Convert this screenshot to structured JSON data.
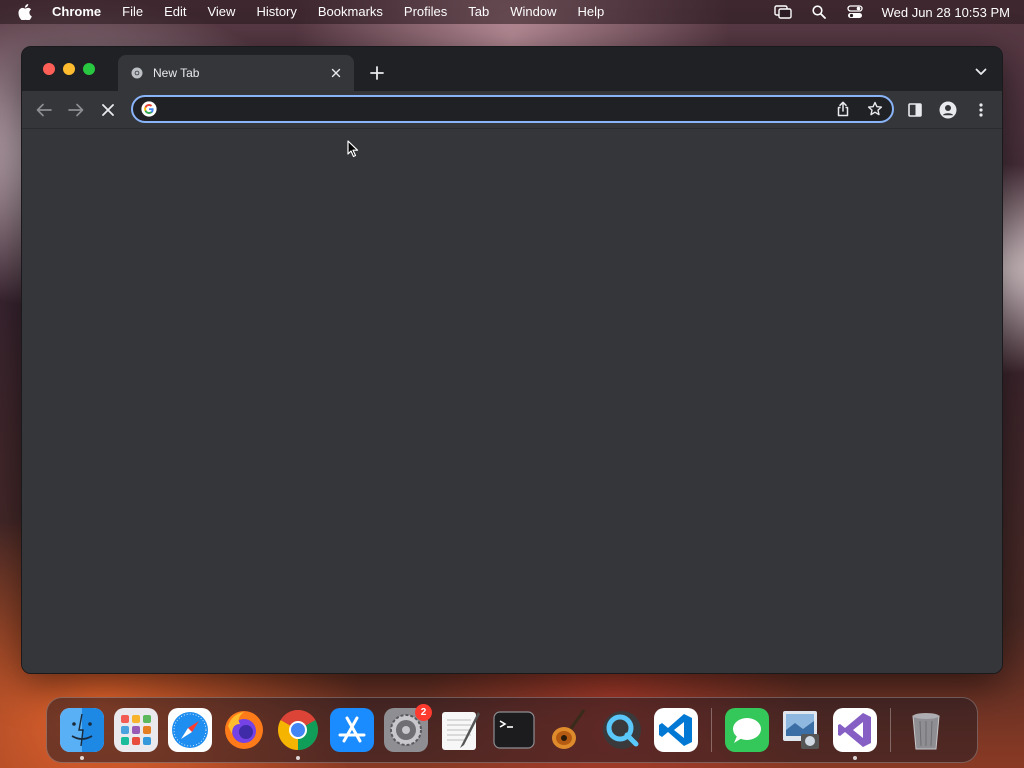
{
  "menubar": {
    "app_name": "Chrome",
    "items": [
      "File",
      "Edit",
      "View",
      "History",
      "Bookmarks",
      "Profiles",
      "Tab",
      "Window",
      "Help"
    ],
    "clock": "Wed Jun 28  10:53 PM",
    "icons": [
      "apple-icon",
      "screen-mirroring-icon",
      "spotlight-search-icon",
      "control-center-icon"
    ]
  },
  "browser": {
    "tab": {
      "title": "New Tab"
    },
    "omnibox": {
      "value": "",
      "placeholder": ""
    },
    "state": "loading",
    "colors": {
      "frame": "#202124",
      "toolbar": "#35363a",
      "focus_ring": "#8ab4f8"
    }
  },
  "dock": {
    "apps": [
      {
        "name": "Finder",
        "icon": "finder-icon",
        "running": true
      },
      {
        "name": "Launchpad",
        "icon": "launchpad-icon",
        "running": false
      },
      {
        "name": "Safari",
        "icon": "safari-icon",
        "running": false
      },
      {
        "name": "Firefox",
        "icon": "firefox-icon",
        "running": false
      },
      {
        "name": "Google Chrome",
        "icon": "chrome-icon",
        "running": true
      },
      {
        "name": "App Store",
        "icon": "app-store-icon",
        "running": false
      },
      {
        "name": "System Preferences",
        "icon": "system-preferences-icon",
        "running": false,
        "badge": "2"
      },
      {
        "name": "TextEdit",
        "icon": "textedit-icon",
        "running": false
      },
      {
        "name": "Terminal",
        "icon": "terminal-icon",
        "running": false
      },
      {
        "name": "GarageBand",
        "icon": "garageband-icon",
        "running": false
      },
      {
        "name": "QuickTime Player",
        "icon": "quicktime-icon",
        "running": false
      },
      {
        "name": "Visual Studio Code",
        "icon": "vscode-icon",
        "running": false
      },
      {
        "name": "Messages",
        "icon": "messages-icon",
        "running": false
      },
      {
        "name": "Preview",
        "icon": "preview-icon",
        "running": false
      },
      {
        "name": "Visual Studio",
        "icon": "visual-studio-icon",
        "running": true
      },
      {
        "name": "Trash",
        "icon": "trash-icon",
        "running": false
      }
    ]
  }
}
